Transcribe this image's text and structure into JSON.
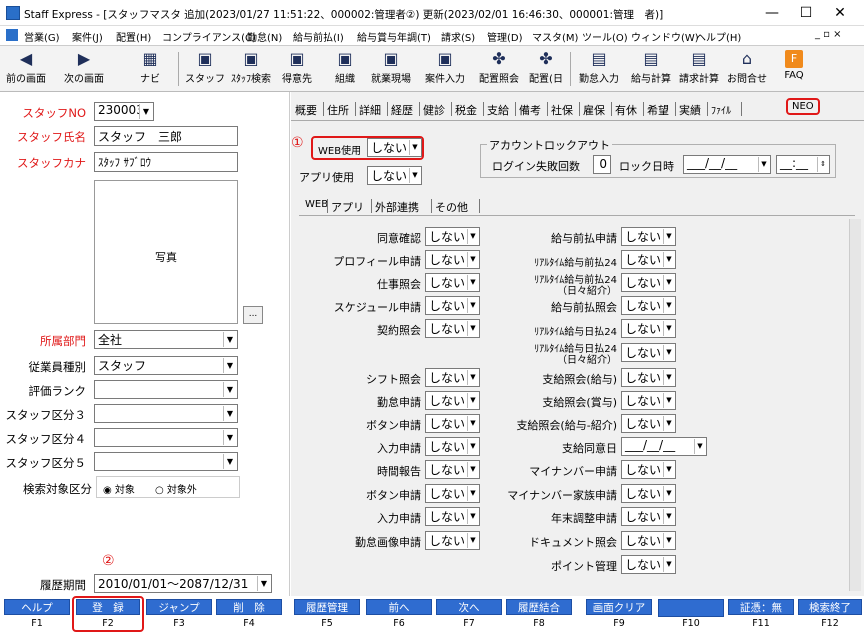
{
  "window": {
    "title": "Staff Express - [スタッフマスタ 追加(2023/01/27 11:51:22、000002:管理者②) 更新(2023/02/01 16:46:30、000001:管理　者)]",
    "minimize": "—",
    "maximize": "☐",
    "close": "✕"
  },
  "menu": [
    "営業(G)",
    "案件(J)",
    "配置(H)",
    "コンプライアンス(C)",
    "勤怠(N)",
    "給与前払(I)",
    "給与賞与年調(T)",
    "請求(S)",
    "管理(D)",
    "マスタ(M)",
    "ツール(O)",
    "ウィンドウ(W)",
    "ヘルプ(H)"
  ],
  "menu_right": "_ ▫ ×",
  "toolbar": [
    {
      "label": "前の画面",
      "icon": "◀"
    },
    {
      "label": "次の画面",
      "icon": "▶"
    },
    {
      "label": "ナビ",
      "icon": "▦"
    },
    {
      "label": "スタッフ",
      "icon": "▣"
    },
    {
      "label": "ｽﾀｯﾌ検索",
      "icon": "▣"
    },
    {
      "label": "得意先",
      "icon": "▣"
    },
    {
      "label": "組織",
      "icon": "▣"
    },
    {
      "label": "就業現場",
      "icon": "▣"
    },
    {
      "label": "案件入力",
      "icon": "▣"
    },
    {
      "label": "配置照会",
      "icon": "✤"
    },
    {
      "label": "配置(日",
      "icon": "✤"
    },
    {
      "label": "勤怠入力",
      "icon": "▤"
    },
    {
      "label": "給与計算",
      "icon": "▤"
    },
    {
      "label": "請求計算",
      "icon": "▤"
    },
    {
      "label": "お問合せ",
      "icon": "⌂"
    },
    {
      "label": "FAQ",
      "icon": "F"
    }
  ],
  "left": {
    "staff_no_label": "スタッフNO",
    "staff_no": "230003",
    "staff_name_label": "スタッフ氏名",
    "staff_name": "スタッフ　三郎",
    "staff_kana_label": "スタッフカナ",
    "staff_kana": "ｽﾀｯﾌ ｻﾌﾞﾛｳ",
    "photo_label": "写真",
    "photo_btn": "...",
    "dept_label": "所属部門",
    "dept": "全社",
    "emp_type_label": "従業員種別",
    "emp_type": "スタッフ",
    "rank_label": "評価ランク",
    "rank": "",
    "cls3_label": "スタッフ区分３",
    "cls3": "",
    "cls4_label": "スタッフ区分４",
    "cls4": "",
    "cls5_label": "スタッフ区分５",
    "cls5": "",
    "search_label": "検索対象区分",
    "search_on": "対象",
    "search_off": "対象外",
    "history_label": "履歴期間",
    "history": "2010/01/01～2087/12/31",
    "marker2": "②"
  },
  "tabs": [
    "概要",
    "住所",
    "詳細",
    "経歴",
    "健診",
    "税金",
    "支給",
    "備考",
    "社保",
    "雇保",
    "有休",
    "希望",
    "実績",
    "ﾌｧｲﾙ",
    "NEO"
  ],
  "neo": {
    "marker1": "①",
    "web_use_label": "WEB使用",
    "web_use": "しない",
    "app_use_label": "アプリ使用",
    "app_use": "しない",
    "lockout_title": "アカウントロックアウト",
    "login_fail_label": "ログイン失敗回数",
    "login_fail": "0",
    "lock_date_label": "ロック日時",
    "lock_date": "___/__/__",
    "lock_time": "__:__",
    "subtabs": [
      "WEB",
      "アプリ",
      "外部連携",
      "その他"
    ],
    "left_fields": [
      {
        "label": "同意確認",
        "value": "しない"
      },
      {
        "label": "プロフィール申請",
        "value": "しない"
      },
      {
        "label": "仕事照会",
        "value": "しない"
      },
      {
        "label": "スケジュール申請",
        "value": "しない"
      },
      {
        "label": "契約照会",
        "value": "しない"
      },
      {
        "label": "シフト照会",
        "value": "しない"
      },
      {
        "label": "勤怠申請",
        "value": "しない"
      },
      {
        "label": "ボタン申請",
        "value": "しない"
      },
      {
        "label": "入力申請",
        "value": "しない"
      },
      {
        "label": "時間報告",
        "value": "しない"
      },
      {
        "label": "ボタン申請",
        "value": "しない"
      },
      {
        "label": "入力申請",
        "value": "しない"
      },
      {
        "label": "勤怠画像申請",
        "value": "しない"
      }
    ],
    "right_fields": [
      {
        "label": "給与前払申請",
        "value": "しない"
      },
      {
        "label": "ﾘｱﾙﾀｲﾑ給与前払24",
        "value": "しない"
      },
      {
        "label": "ﾘｱﾙﾀｲﾑ給与前払24",
        "label2": "（日々紹介）",
        "value": "しない"
      },
      {
        "label": "給与前払照会",
        "value": "しない"
      },
      {
        "label": "ﾘｱﾙﾀｲﾑ給与日払24",
        "value": "しない"
      },
      {
        "label": "ﾘｱﾙﾀｲﾑ給与日払24",
        "label2": "（日々紹介）",
        "value": "しない"
      },
      {
        "label": "支給照会(給与)",
        "value": "しない"
      },
      {
        "label": "支給照会(賞与)",
        "value": "しない"
      },
      {
        "label": "支給照会(給与-紹介)",
        "value": "しない"
      },
      {
        "label": "支給同意日",
        "value": "___/__/__"
      },
      {
        "label": "マイナンバー申請",
        "value": "しない"
      },
      {
        "label": "マイナンバー家族申請",
        "value": "しない"
      },
      {
        "label": "年末調整申請",
        "value": "しない"
      },
      {
        "label": "ドキュメント照会",
        "value": "しない"
      },
      {
        "label": "ポイント管理",
        "value": "しない"
      }
    ]
  },
  "fkeys": [
    {
      "label": "ヘルプ",
      "key": "F1"
    },
    {
      "label": "登　録",
      "key": "F2"
    },
    {
      "label": "ジャンプ",
      "key": "F3"
    },
    {
      "label": "削　除",
      "key": "F4"
    },
    {
      "label": "履歴管理",
      "key": "F5"
    },
    {
      "label": "前へ",
      "key": "F6"
    },
    {
      "label": "次へ",
      "key": "F7"
    },
    {
      "label": "履歴結合",
      "key": "F8"
    },
    {
      "label": "画面クリア",
      "key": "F9"
    },
    {
      "label": "",
      "key": "F10"
    },
    {
      "label": "証憑：無",
      "key": "F11"
    },
    {
      "label": "検索終了",
      "key": "F12"
    }
  ]
}
